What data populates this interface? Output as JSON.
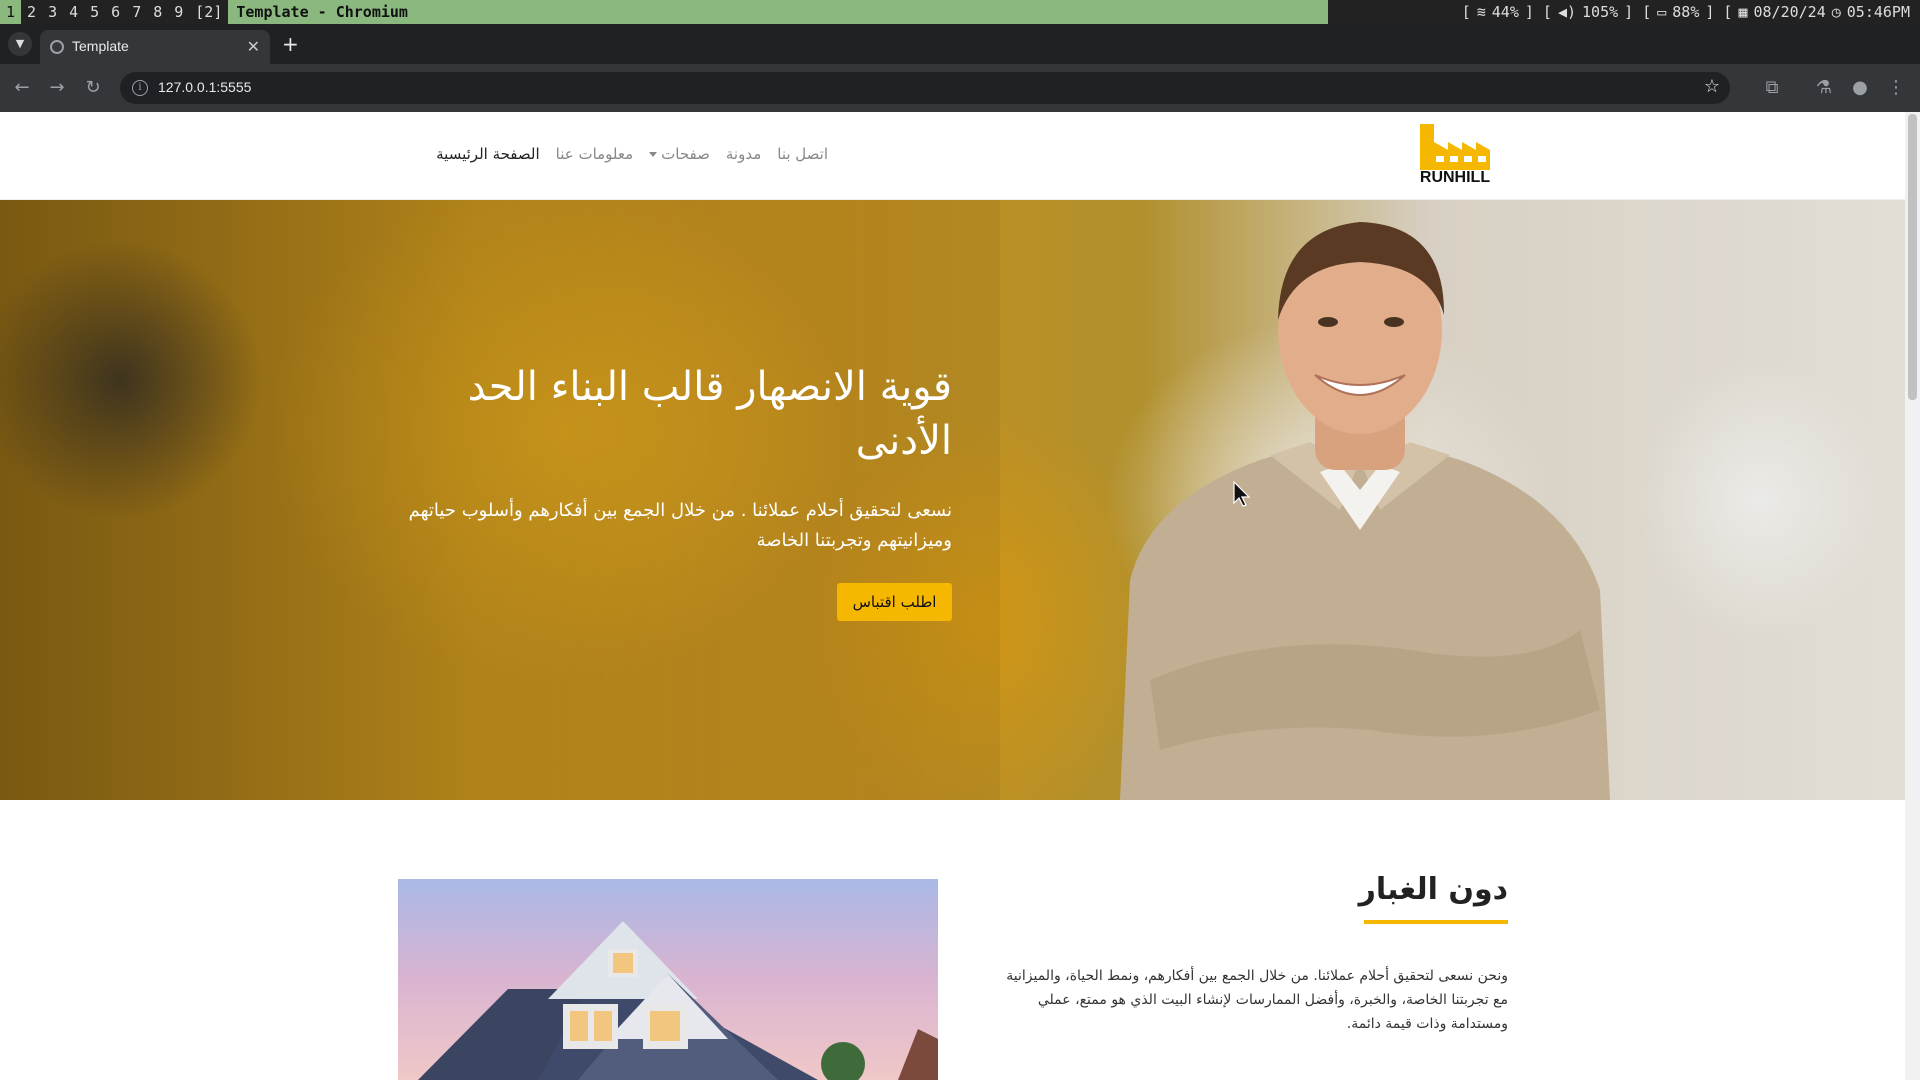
{
  "wm": {
    "workspaces": [
      "1",
      "2",
      "3",
      "4",
      "5",
      "6",
      "7",
      "8",
      "9",
      "[2]"
    ],
    "active_workspace": "1",
    "window_title": "Template - Chromium",
    "status": {
      "wifi": "44%",
      "volume": "105%",
      "battery": "88%",
      "date": "08/20/24",
      "time": "05:46PM"
    }
  },
  "browser": {
    "tab_title": "Template",
    "url": "127.0.0.1:5555"
  },
  "site": {
    "logo_text": "RUNHILL",
    "nav": {
      "home": "الصفحة الرئيسية",
      "about": "معلومات عنا",
      "pages": "صفحات",
      "blog": "مدونة",
      "contact": "اتصل بنا"
    },
    "hero": {
      "title": "قوية الانصهار قالب البناء الحد الأدنى",
      "text": "نسعى لتحقيق أحلام عملائنا . من خلال الجمع بين أفكارهم وأسلوب حياتهم وميزانيتهم وتجربتنا الخاصة",
      "cta": "اطلب اقتباس"
    },
    "about": {
      "title": "دون الغبار",
      "text": "ونحن نسعى لتحقيق أحلام عملائنا. من خلال الجمع بين أفكارهم، ونمط الحياة، والميزانية مع تجربتنا الخاصة، والخبرة، وأفضل الممارسات لإنشاء البيت الذي هو ممتع، عملي ومستدامة وذات قيمة دائمة."
    }
  },
  "colors": {
    "accent": "#f5b700",
    "wm_green": "#8bb87f"
  }
}
